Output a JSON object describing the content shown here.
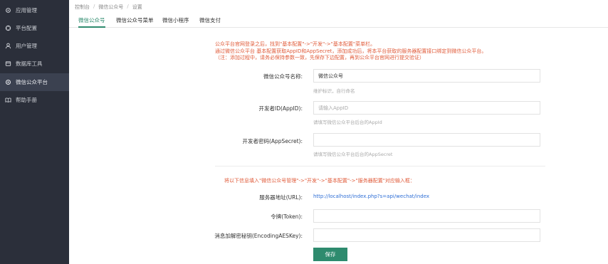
{
  "sidebar": {
    "items": [
      {
        "label": "应用管理",
        "icon": "gear-icon"
      },
      {
        "label": "平台配置",
        "icon": "settings-icon"
      },
      {
        "label": "用户管理",
        "icon": "user-icon"
      },
      {
        "label": "数据库工具",
        "icon": "database-icon"
      },
      {
        "label": "微信公众平台",
        "icon": "wechat-icon"
      },
      {
        "label": "帮助手册",
        "icon": "book-icon"
      }
    ],
    "active_index": 4
  },
  "breadcrumb": [
    "控制台",
    "微信公众号",
    "设置"
  ],
  "tabs": [
    "微信公众号",
    "微信公众号菜单",
    "微信小程序",
    "微信支付"
  ],
  "notice": {
    "line1": "公众平台官网登录之后，找到\"基本配置\"->\"开发\"->\"基本配置\"菜单栏。",
    "line2": "通过微信公众平台 基本配置获取AppID和AppSecret，添加成功后，将本平台获取的服务器配置接口绑定到微信公众平台。",
    "line3": "（注：添加过程中，请务必保持参数一致，先保存下边配置，再到公众平台官网进行提交验证）"
  },
  "form": {
    "name_label": "微信公众号名称:",
    "name_value": "微信公众号",
    "name_hint": "维护标识，自行命名",
    "appid_label": "开发者ID(AppID):",
    "appid_placeholder": "请输入AppID",
    "appid_hint": "请填写微信公众平台后台的AppId",
    "secret_label": "开发者密码(AppSecret):",
    "secret_value": "",
    "secret_hint": "请填写微信公众平台后台的AppSecret"
  },
  "server": {
    "notice": "将以下信息填入\"微信公众号管理\"->\"开发\"->\"基本配置\"->\"服务器配置\"对应输入框：",
    "url_label": "服务器地址(URL):",
    "url_value": "http://localhost/index.php?s=api/wechat/index",
    "token_label": "令牌(Token):",
    "token_value": "",
    "aes_label": "消息加解密秘钥(EncodingAESKey):",
    "aes_value": ""
  },
  "save_label": "保存",
  "colors": {
    "sidebar_bg": "#2b2f3a",
    "accent": "#2e8b6e",
    "notice": "#e05b3a",
    "link": "#2f6fd6"
  }
}
